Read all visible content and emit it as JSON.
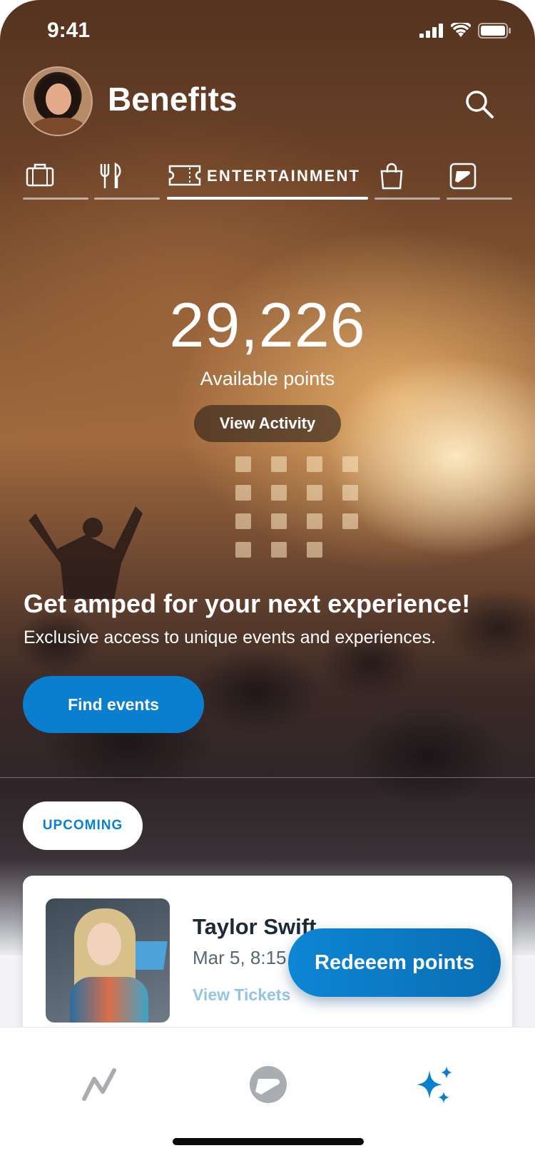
{
  "status_bar": {
    "time": "9:41"
  },
  "header": {
    "title": "Benefits"
  },
  "category_tabs": [
    {
      "icon": "briefcase-icon",
      "label": ""
    },
    {
      "icon": "fork-knife-icon",
      "label": ""
    },
    {
      "icon": "ticket-icon",
      "label": "ENTERTAINMENT",
      "active": true
    },
    {
      "icon": "shopping-bag-icon",
      "label": ""
    },
    {
      "icon": "brand-logo-icon",
      "label": ""
    }
  ],
  "points": {
    "value": "29,226",
    "label": "Available points",
    "activity_button": "View Activity"
  },
  "promo": {
    "title": "Get amped for your next experience!",
    "subtitle": "Exclusive access to unique events and experiences.",
    "button": "Find events"
  },
  "upcoming": {
    "label": "UPCOMING"
  },
  "event": {
    "name": "Taylor Swift",
    "date": "Mar 5, 8:15",
    "link": "View Tickets"
  },
  "redeem_button": "Redeeem points",
  "bottom_nav": [
    {
      "icon": "activity-icon",
      "active": false
    },
    {
      "icon": "brand-logo-icon",
      "active": false
    },
    {
      "icon": "sparkles-icon",
      "active": true
    }
  ],
  "colors": {
    "accent": "#0a7fd0",
    "inactive_icon": "#a9adb2",
    "event_link": "#95c3e6"
  }
}
